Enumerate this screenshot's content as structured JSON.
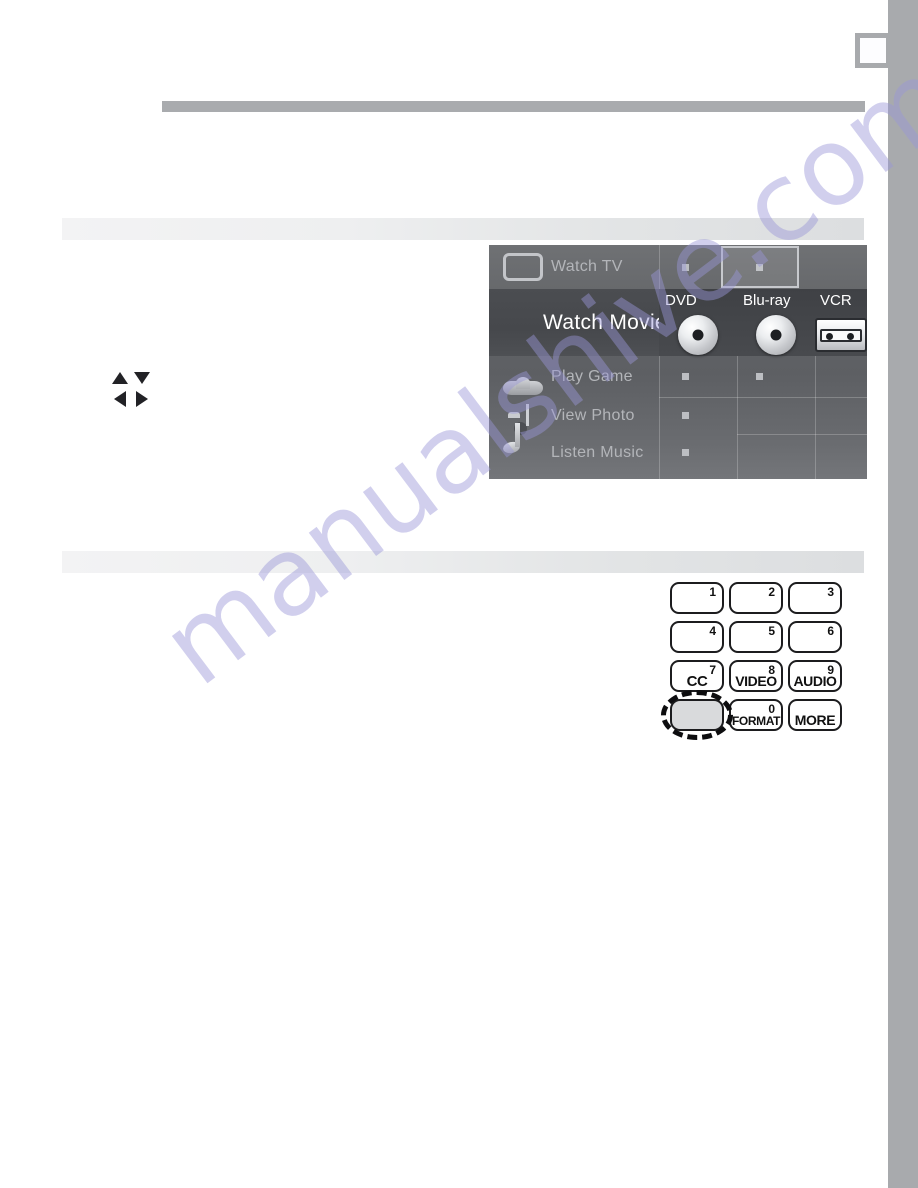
{
  "page": {
    "background_color": "#ffffff",
    "edge_strip_color": "#a8aaad",
    "rule_color": "#a9abae",
    "watermark": "manualshive.com",
    "watermark_color": "#9a97d8"
  },
  "nav_arrows": {
    "up": "up-arrow",
    "down": "down-arrow",
    "left": "left-arrow",
    "right": "right-arrow"
  },
  "tv_menu": {
    "rows": [
      {
        "label": "Watch TV",
        "icon": "tv-icon",
        "selected": false
      },
      {
        "label": "Watch Movie",
        "icon": "film-icon",
        "selected": true
      },
      {
        "label": "Play Game",
        "icon": "gamepad-icon",
        "selected": false
      },
      {
        "label": "View Photo",
        "icon": "camera-icon",
        "selected": false
      },
      {
        "label": "Listen Music",
        "icon": "music-note-icon",
        "selected": false
      }
    ],
    "sources": [
      {
        "label": "DVD",
        "icon": "disc-icon"
      },
      {
        "label": "Blu-ray",
        "icon": "disc-icon"
      },
      {
        "label": "VCR",
        "icon": "videotape-icon"
      }
    ],
    "highlight_cell": "watch-tv-column-2",
    "colors": {
      "menu_background": "#636568",
      "selected_row": "#4b4d51",
      "label_text": "#b3b5b9",
      "selected_label_text": "#ffffff",
      "marker": "#bcbec2"
    }
  },
  "remote_keypad": {
    "keys": [
      {
        "id": "key-1",
        "number": "1",
        "label": ""
      },
      {
        "id": "key-2",
        "number": "2",
        "label": ""
      },
      {
        "id": "key-3",
        "number": "3",
        "label": ""
      },
      {
        "id": "key-4",
        "number": "4",
        "label": ""
      },
      {
        "id": "key-5",
        "number": "5",
        "label": ""
      },
      {
        "id": "key-6",
        "number": "6",
        "label": ""
      },
      {
        "id": "key-cc",
        "number": "7",
        "label": "CC"
      },
      {
        "id": "key-video",
        "number": "8",
        "label": "VIDEO"
      },
      {
        "id": "key-audio",
        "number": "9",
        "label": "AUDIO"
      },
      {
        "id": "key-format",
        "number": "0",
        "label": "FORMAT"
      },
      {
        "id": "key-more",
        "number": "",
        "label": "MORE"
      }
    ],
    "highlighted_key": {
      "id": "key-source",
      "number": "",
      "label": ""
    }
  }
}
